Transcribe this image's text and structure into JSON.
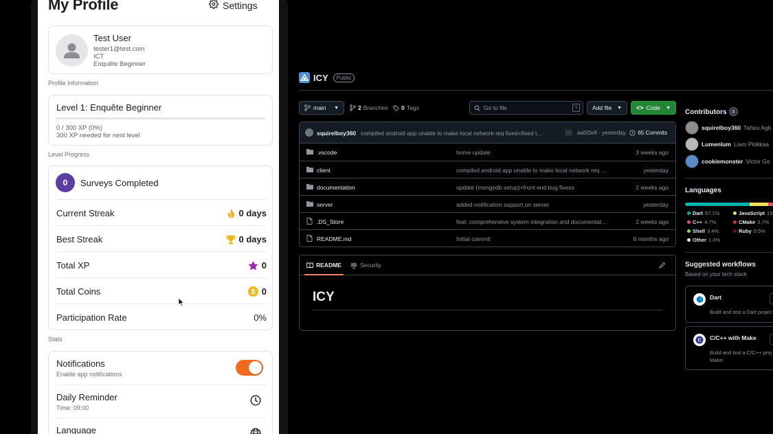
{
  "phone": {
    "title": "My Profile",
    "settings_label": "Settings",
    "profile": {
      "name": "Test User",
      "email": "tester1@test.com",
      "department": "ICT",
      "rank": "Enquête Beginner"
    },
    "profile_section_label": "Profile Information",
    "level": {
      "title": "Level 1: Enquête Beginner",
      "progress_fraction": 0.0,
      "xp_text": "0 / 300 XP (0%)",
      "next_text": "300 XP needed for next level"
    },
    "level_section_label": "Level Progress",
    "surveys": {
      "count": "0",
      "label": "Surveys Completed"
    },
    "stats": [
      {
        "label": "Current Streak",
        "value": "0 days",
        "icon": "fire-icon"
      },
      {
        "label": "Best Streak",
        "value": "0 days",
        "icon": "trophy-icon"
      },
      {
        "label": "Total XP",
        "value": "0",
        "icon": "star-icon"
      },
      {
        "label": "Total Coins",
        "value": "0",
        "icon": "coin-icon"
      },
      {
        "label": "Participation Rate",
        "value": "0%",
        "icon": ""
      }
    ],
    "stats_section_label": "Stats",
    "settings": {
      "notifications": {
        "title": "Notifications",
        "subtitle": "Enable app notifications",
        "enabled": true
      },
      "reminder": {
        "title": "Daily Reminder",
        "subtitle": "Time: 09:00"
      },
      "language": {
        "title": "Language"
      }
    },
    "colors": {
      "accent": "#5b3fa3",
      "toggle_on": "#f26a1b"
    }
  },
  "github": {
    "repo_name": "ICY",
    "visibility": "Public",
    "branch": "main",
    "branches": {
      "count": "2",
      "label": "Branches"
    },
    "tags": {
      "count": "0",
      "label": "Tags"
    },
    "search_placeholder": "Go to file",
    "search_shortcut": "t",
    "add_file_label": "Add file",
    "code_label": "Code",
    "latest_commit": {
      "user": "squirelboy360",
      "message": "compiled android app unable to make local network req fixed+fixed t…",
      "dots": "...",
      "hash_time": "aa5f2e9 · yesterday",
      "commits": "65 Commits"
    },
    "files": [
      {
        "name": ".vscode",
        "type": "dir",
        "message": "home update",
        "time": "3 weeks ago"
      },
      {
        "name": "client",
        "type": "dir",
        "message": "compiled android app unable to make local network req …",
        "time": "yesterday"
      },
      {
        "name": "documentation",
        "type": "dir",
        "message": "update (mongodb setup)+front end bug fixess",
        "time": "2 weeks ago"
      },
      {
        "name": "server",
        "type": "dir",
        "message": "added notification support on server",
        "time": "yesterday"
      },
      {
        "name": ".DS_Store",
        "type": "file",
        "message": "feat: comprehensive system integration and documentat…",
        "time": "2 weeks ago"
      },
      {
        "name": "README.md",
        "type": "file",
        "message": "Initial commit",
        "time": "8 months ago"
      }
    ],
    "readme": {
      "tab_readme": "README",
      "tab_security": "Security",
      "heading": "ICY"
    },
    "sidebar": {
      "contributors_title": "Contributors",
      "contributors_count": "3",
      "contributors": [
        {
          "user": "squirelboy360",
          "full": "Tahiru Agb"
        },
        {
          "user": "Lumenlum",
          "full": "Liam Plokkaa"
        },
        {
          "user": "cookiemonster",
          "full": "Victor Ge"
        }
      ],
      "languages_title": "Languages",
      "languages": [
        {
          "name": "Dart",
          "pct": "67.1%",
          "color": "#00b4ab",
          "share": 67.1
        },
        {
          "name": "JavaScript",
          "pct": "19",
          "color": "#f1e05a",
          "share": 19.4
        },
        {
          "name": "C++",
          "pct": "4.7%",
          "color": "#f34b7d",
          "share": 4.7
        },
        {
          "name": "CMake",
          "pct": "3.7%",
          "color": "#da3434",
          "share": 3.7
        },
        {
          "name": "Shell",
          "pct": "3.4%",
          "color": "#89e051",
          "share": 3.4
        },
        {
          "name": "Ruby",
          "pct": "0.5%",
          "color": "#701516",
          "share": 0.5
        },
        {
          "name": "Other",
          "pct": "1.0%",
          "color": "#ededed",
          "share": 1.0
        }
      ],
      "workflows_title": "Suggested workflows",
      "workflows_subtitle": "Based on your tech stack",
      "workflows": [
        {
          "name": "Dart",
          "desc1": "Build and test a Dart projec",
          "desc2": ""
        },
        {
          "name": "C/C++ with Make",
          "desc1": "Build and test a C/C++ proj",
          "desc2": "Make."
        }
      ]
    }
  }
}
